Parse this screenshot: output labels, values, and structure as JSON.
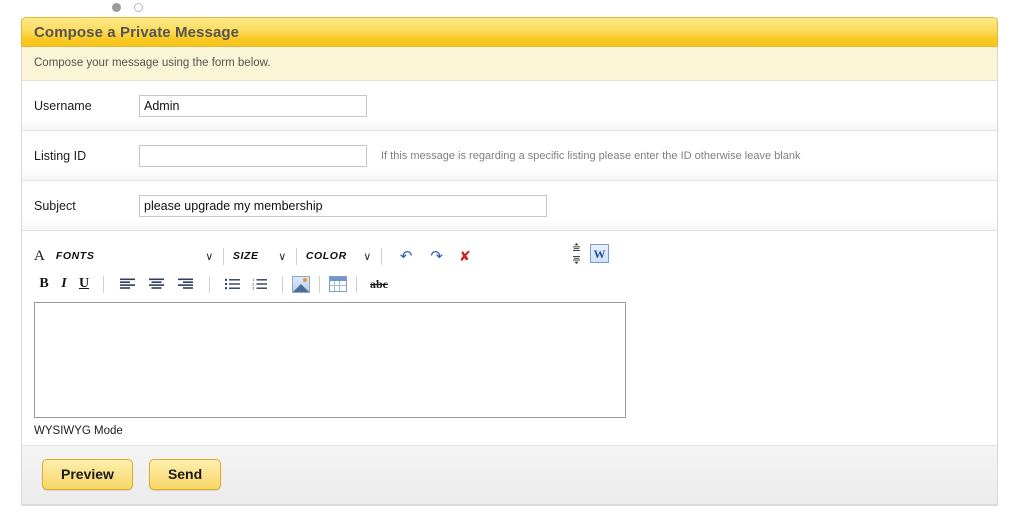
{
  "pager": {
    "dots": [
      {
        "state": "filled",
        "name": "pager-dot-1"
      },
      {
        "state": "hollow",
        "name": "pager-dot-2"
      }
    ]
  },
  "panel": {
    "title": "Compose a Private Message",
    "description": "Compose your message using the form below."
  },
  "form": {
    "username": {
      "label": "Username",
      "value": "Admin",
      "placeholder": ""
    },
    "listing_id": {
      "label": "Listing ID",
      "value": "",
      "placeholder": "",
      "hint": "If this message is regarding a specific listing please enter the ID otherwise leave blank"
    },
    "subject": {
      "label": "Subject",
      "value": "please upgrade my membership",
      "placeholder": ""
    },
    "body": {
      "value": "",
      "mode_label": "WYSIWYG Mode"
    }
  },
  "editor_toolbar": {
    "row1": {
      "font_style_glyph": "A",
      "fonts": {
        "label": "FONTS",
        "caret": "∨"
      },
      "size": {
        "label": "SIZE",
        "caret": "∨"
      },
      "color": {
        "label": "COLOR",
        "caret": "∨"
      },
      "undo": "↶",
      "redo": "↷",
      "remove_format": "✘"
    },
    "row2": {
      "bold": "B",
      "italic": "I",
      "underline": "U",
      "strikethrough": "abc"
    }
  },
  "buttons": {
    "preview": "Preview",
    "send": "Send"
  },
  "colors": {
    "header_gold": "#f8c51c",
    "subheader_cream": "#faf5d7",
    "button_yellow": "#fbe28b",
    "button_border": "#d9ad2e",
    "hint_gray": "#7f7f7f"
  }
}
